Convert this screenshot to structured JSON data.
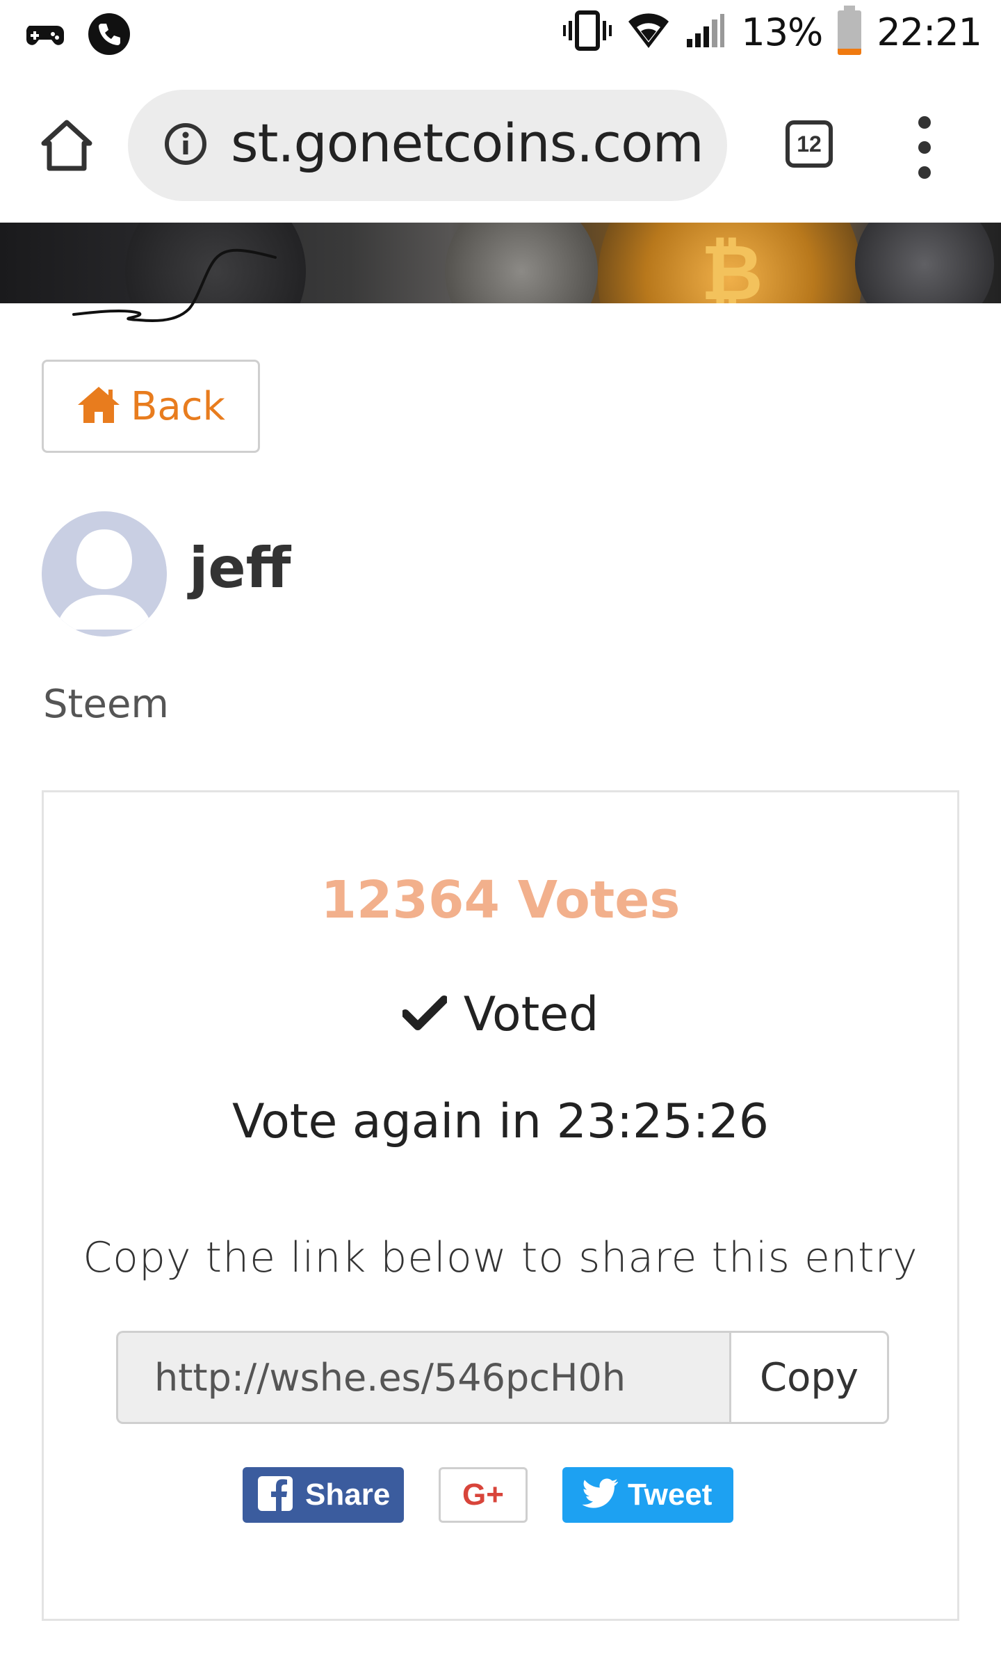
{
  "status_bar": {
    "battery_percent": "13%",
    "time": "22:21",
    "left_icons": [
      "gamepad-icon",
      "phone-call-icon"
    ],
    "right_icons": [
      "vibrate-icon",
      "wifi-icon",
      "signal-icon",
      "battery-icon"
    ]
  },
  "browser": {
    "url": "st.gonetcoins.com",
    "tab_count": "12",
    "icons": [
      "home-icon",
      "info-icon",
      "tabs-icon",
      "overflow-menu-icon"
    ]
  },
  "page": {
    "back_label": "Back",
    "user": {
      "name": "jeff",
      "category": "Steem"
    },
    "vote_card": {
      "votes": "12364 Votes",
      "voted_label": "Voted",
      "vote_again": "Vote again in 23:25:26",
      "share_prompt": "Copy the link below to share this entry",
      "share_link": "http://wshe.es/546pcH0h",
      "copy_label": "Copy",
      "facebook_label": "Share",
      "googleplus_label": "G+",
      "twitter_label": "Tweet"
    }
  },
  "colors": {
    "accent_orange": "#e87c1e",
    "votes_color": "#f2b08c",
    "facebook_blue": "#3b5c9e",
    "twitter_blue": "#1da1f2",
    "google_red": "#d8443a"
  }
}
